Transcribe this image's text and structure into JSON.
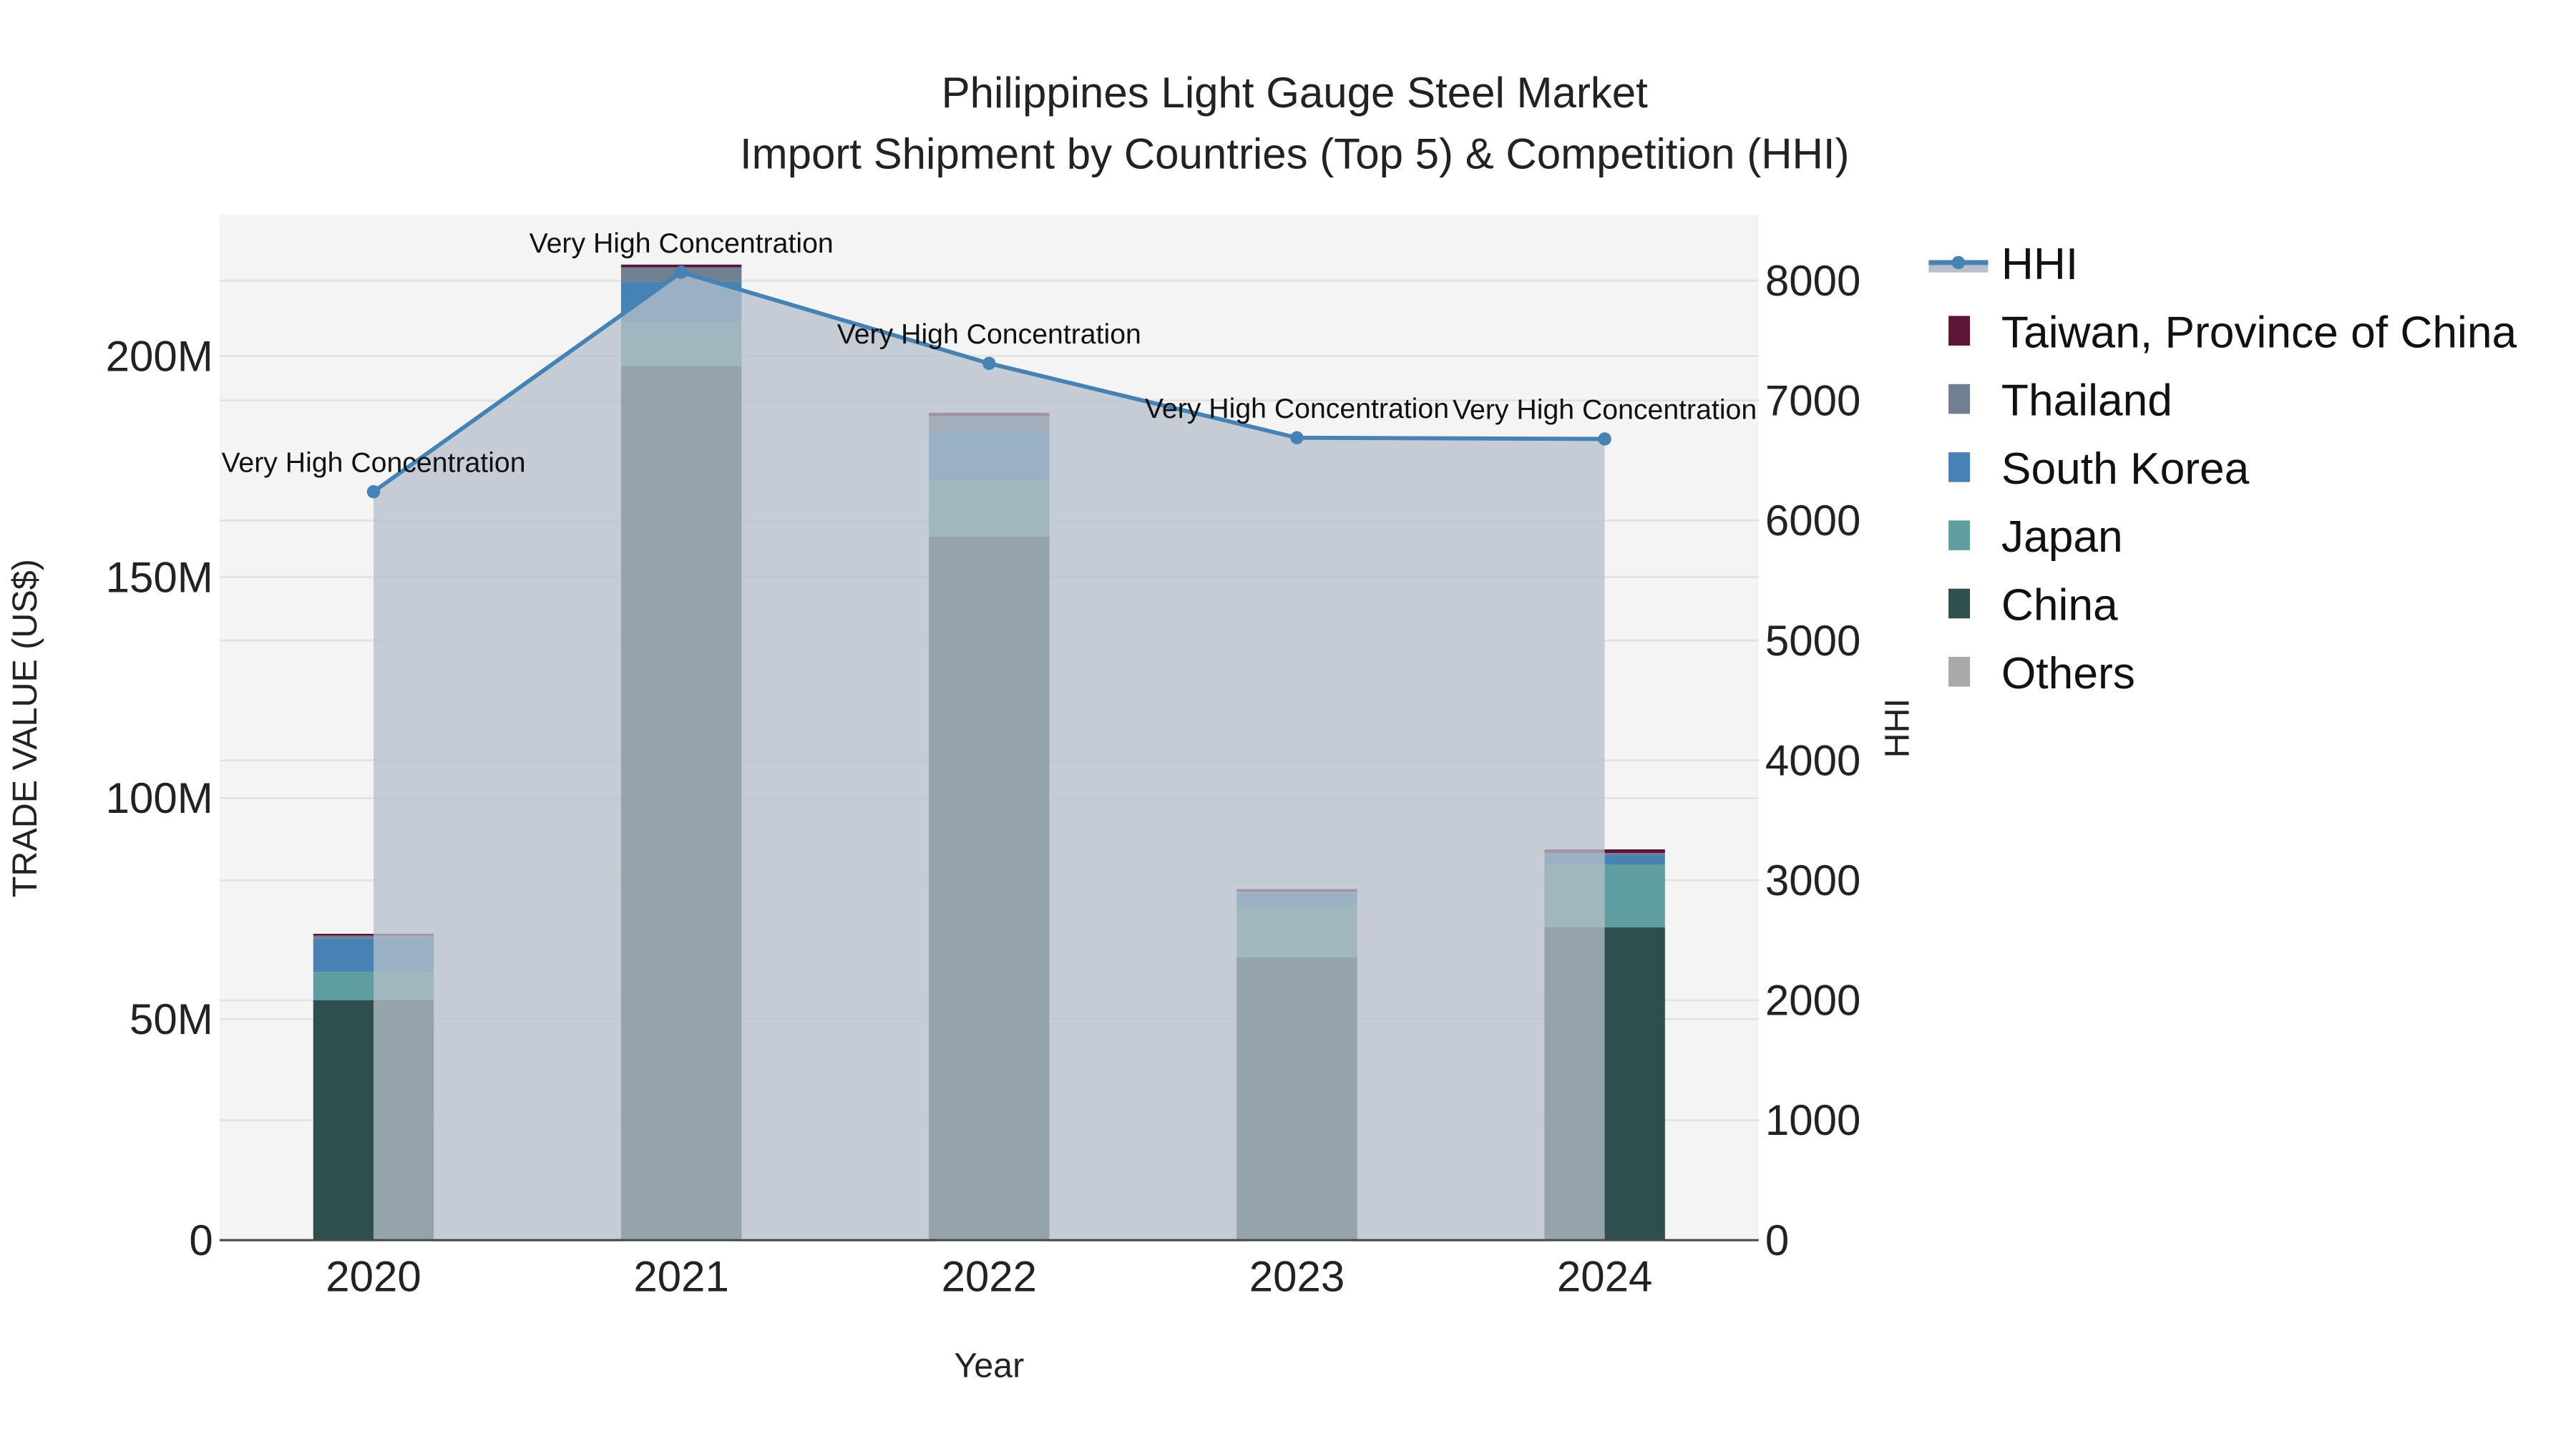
{
  "chart_data": {
    "type": "bar",
    "title": "Philippines Light Gauge Steel Market",
    "subtitle": "Import Shipment by Countries (Top 5) & Competition (HHI)",
    "xlabel": "Year",
    "ylabel": "TRADE VALUE (US$)",
    "y2label": "HHI",
    "categories": [
      "2020",
      "2021",
      "2022",
      "2023",
      "2024"
    ],
    "ylim": [
      0,
      232
    ],
    "y_ticks": [
      0,
      50,
      100,
      150,
      200
    ],
    "y_tick_labels": [
      "0",
      "50M",
      "100M",
      "150M",
      "200M"
    ],
    "y2lim": [
      0,
      8550
    ],
    "y2_ticks": [
      0,
      1000,
      2000,
      3000,
      4000,
      5000,
      6000,
      7000,
      8000
    ],
    "y2_tick_labels": [
      "0",
      "1000",
      "2000",
      "3000",
      "4000",
      "5000",
      "6000",
      "7000",
      "8000"
    ],
    "units": "million US$",
    "series": [
      {
        "name": "Others",
        "color": "#A9A9A9",
        "values": [
          0,
          0,
          0,
          0,
          0
        ]
      },
      {
        "name": "China",
        "color": "#2F4F4F",
        "values": [
          54.3,
          197.8,
          159.2,
          64.0,
          70.8
        ]
      },
      {
        "name": "Japan",
        "color": "#5F9EA0",
        "values": [
          6.4,
          10.1,
          12.7,
          11.7,
          14.2
        ]
      },
      {
        "name": "South Korea",
        "color": "#4682B4",
        "values": [
          7.5,
          9.0,
          11.2,
          2.7,
          2.1
        ]
      },
      {
        "name": "Thailand",
        "color": "#708090",
        "values": [
          0.7,
          3.2,
          3.3,
          0.4,
          0.5
        ]
      },
      {
        "name": "Taiwan, Province of China",
        "color": "#5E1638",
        "values": [
          0.4,
          0.6,
          0.8,
          0.6,
          0.8
        ]
      }
    ],
    "line": {
      "name": "HHI",
      "color": "#4682B4",
      "fill": "#B7BFCB",
      "values": [
        6240,
        8070,
        7310,
        6690,
        6680
      ],
      "annotations": [
        "Very High Concentration",
        "Very High Concentration",
        "Very High Concentration",
        "Very High Concentration",
        "Very High Concentration"
      ]
    },
    "legend_order": [
      "HHI",
      "Taiwan, Province of China",
      "Thailand",
      "South Korea",
      "Japan",
      "China",
      "Others"
    ],
    "legend_placement": "right",
    "grid": true
  }
}
